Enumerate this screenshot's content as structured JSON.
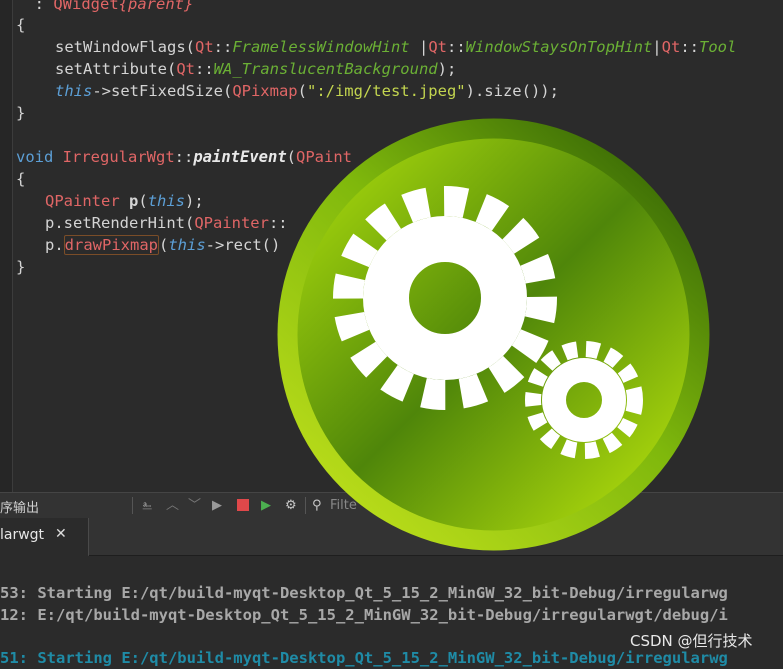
{
  "editor": {
    "lines": {
      "l0": {
        "indent": "  : ",
        "cls": "QWidget",
        "brace": "{",
        "param": "parent",
        "brace2": "}"
      },
      "l1": "{",
      "l2": {
        "fn": "setWindowFlags(",
        "q1": "Qt",
        "s1": "::",
        "v1": "FramelessWindowHint",
        "pipe1": " |",
        "q2": "Qt",
        "s2": "::",
        "v2": "WindowStaysOnTopHint",
        "pipe2": "|",
        "q3": "Qt",
        "s3": "::",
        "v3": "Tool"
      },
      "l3": {
        "fn": "setAttribute(",
        "q1": "Qt",
        "s1": "::",
        "v1": "WA_TranslucentBackground",
        "end": ");"
      },
      "l4": {
        "kw": "this",
        "a": "->setFixedSize(",
        "cls": "QPixmap",
        "b": "(",
        "str": "\":/img/test.jpeg\"",
        "c": ").size());"
      },
      "l5": "}",
      "l6": {
        "kw": "void ",
        "cls": "IrregularWgt",
        "s": "::",
        "fn": "paintEvent",
        "p": "(",
        "cls2": "QPaint"
      },
      "l7": "{",
      "l8": {
        "cls": "QPainter ",
        "var": "p",
        "a": "(",
        "kw": "this",
        "b": ");"
      },
      "l9": {
        "a": "p.setRenderHint(",
        "cls": "QPainter",
        "b": "::"
      },
      "l10": {
        "a": "p.",
        "fn": "drawPixmap",
        "b": "(",
        "kw": "this",
        "c": "->rect()"
      },
      "l11": "}"
    }
  },
  "toolbar": {
    "label": "序输出",
    "filter_placeholder": "Filte"
  },
  "tab": {
    "label": "larwgt",
    "close": "✕"
  },
  "output": {
    "line1": "53: Starting E:/qt/build-myqt-Desktop_Qt_5_15_2_MinGW_32_bit-Debug/irregularwg",
    "line2": "12: E:/qt/build-myqt-Desktop_Qt_5_15_2_MinGW_32_bit-Debug/irregularwgt/debug/i",
    "line3": "51: Starting E:/qt/build-myqt-Desktop_Qt_5_15_2_MinGW_32_bit-Debug/irregularwg"
  },
  "watermark": "CSDN @但行技术",
  "colors": {
    "accent_green": "#9fcd0c",
    "dark_green": "#3b6b05",
    "editor_bg": "#2b2b2b"
  }
}
